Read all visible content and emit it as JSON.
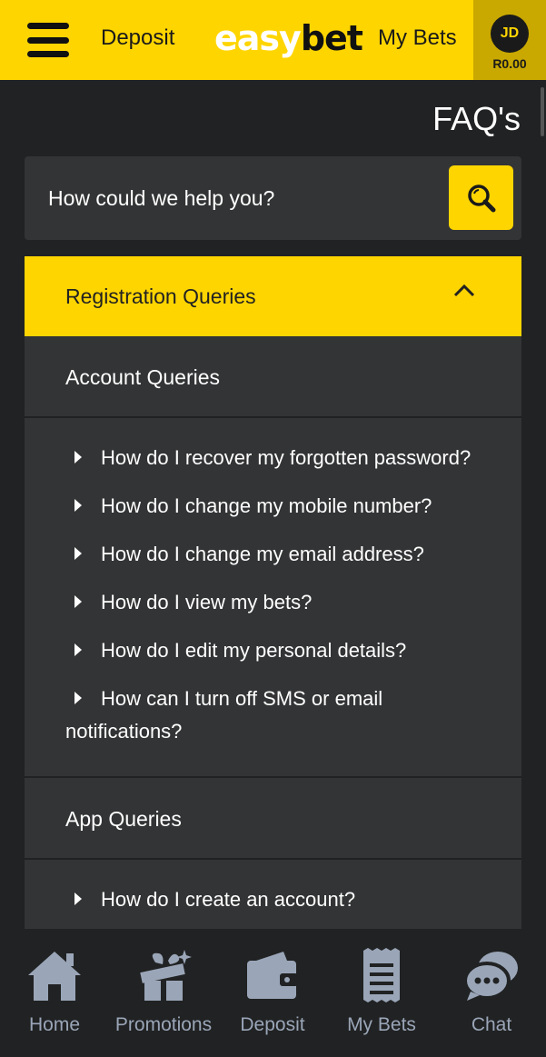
{
  "header": {
    "deposit_label": "Deposit",
    "logo_easy": "easy",
    "logo_bet": "bet",
    "mybets_label": "My Bets",
    "avatar_initials": "JD",
    "balance": "R0.00"
  },
  "page_title": "FAQ's",
  "search": {
    "placeholder": "How could we help you?"
  },
  "faq": {
    "open_category": "Registration Queries",
    "categories": [
      {
        "label": "Account Queries",
        "questions": [
          "How do I recover my forgotten password?",
          "How do I change my mobile number?",
          "How do I change my email address?",
          "How do I view my bets?",
          "How do I edit my personal details?",
          "How can I turn off SMS or email notifications?"
        ]
      },
      {
        "label": "App Queries",
        "questions": [
          "How do I create an account?"
        ]
      }
    ]
  },
  "bottom_nav": [
    {
      "label": "Home",
      "icon": "home-icon"
    },
    {
      "label": "Promotions",
      "icon": "gift-icon"
    },
    {
      "label": "Deposit",
      "icon": "wallet-icon"
    },
    {
      "label": "My Bets",
      "icon": "receipt-icon"
    },
    {
      "label": "Chat",
      "icon": "chat-icon"
    }
  ],
  "colors": {
    "brand_yellow": "#ffd500",
    "background": "#212223",
    "panel": "#333435",
    "nav_icon": "#9aa6b8"
  }
}
